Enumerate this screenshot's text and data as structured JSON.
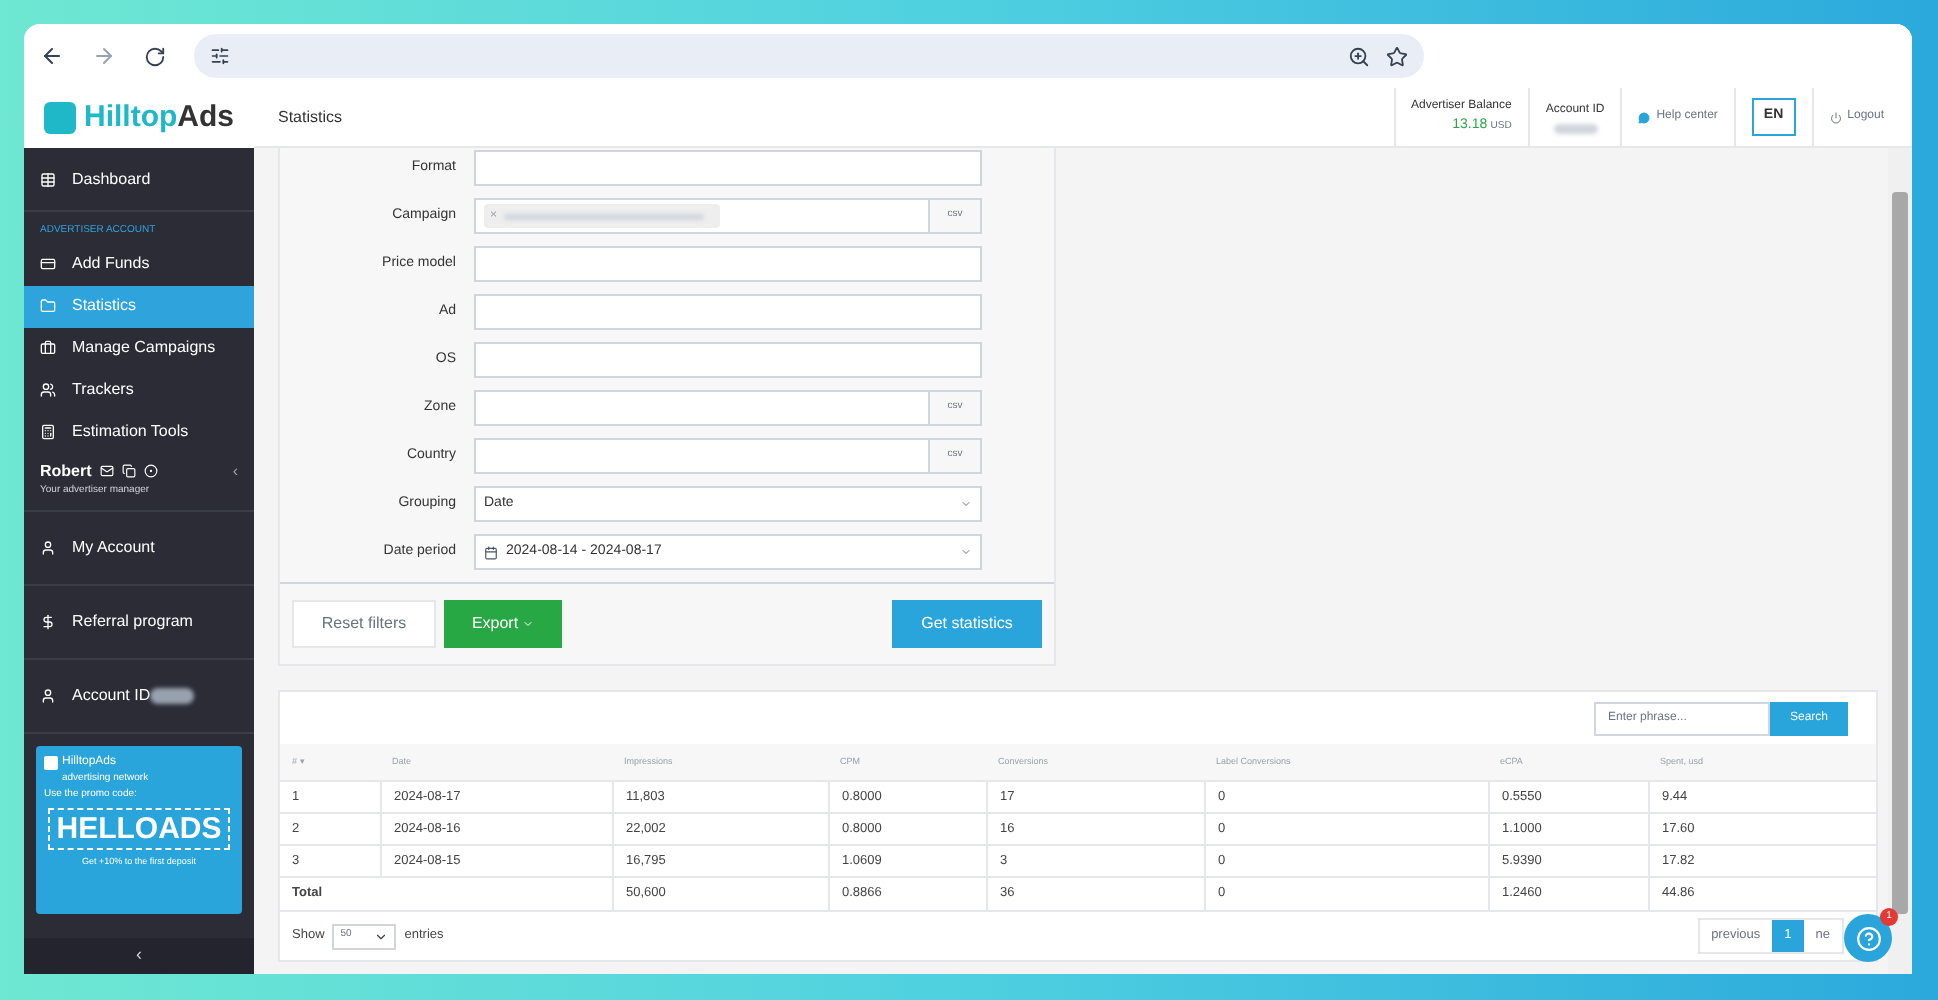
{
  "header": {
    "logo": [
      "Hilltop",
      "Ads"
    ],
    "title": "Statistics",
    "balance_label": "Advertiser Balance",
    "balance_value": "13.18",
    "balance_currency": "USD",
    "account_label": "Account ID",
    "help": "Help center",
    "language": "EN",
    "logout": "Logout"
  },
  "sidebar": {
    "top_items": [
      {
        "label": "Dashboard",
        "selected": false
      }
    ],
    "section_label": "ADVERTISER ACCOUNT",
    "account_items": [
      {
        "label": "Add Funds",
        "selected": false
      },
      {
        "label": "Statistics",
        "selected": true
      },
      {
        "label": "Manage Campaigns",
        "selected": false
      },
      {
        "label": "Trackers",
        "selected": false
      },
      {
        "label": "Estimation Tools",
        "selected": false
      }
    ],
    "manager": {
      "name": "Robert",
      "role": "Your advertiser manager",
      "collapse": "‹"
    },
    "bottom_items": [
      {
        "label": "My Account"
      },
      {
        "label": "Referral program"
      },
      {
        "label": "Account ID"
      }
    ],
    "promo": {
      "brand": "HilltopAds",
      "tagline": "advertising network",
      "intro": "Use the promo code:",
      "code": "HELLOADS",
      "offer": "Get +10% to the first deposit"
    },
    "collapse": "‹"
  },
  "filters": {
    "fields": [
      {
        "label": "Format",
        "kind": "text"
      },
      {
        "label": "Campaign",
        "kind": "tag",
        "tag_remove": "×",
        "csv": "csv"
      },
      {
        "label": "Price model",
        "kind": "text"
      },
      {
        "label": "Ad",
        "kind": "text"
      },
      {
        "label": "OS",
        "kind": "text"
      },
      {
        "label": "Zone",
        "kind": "csv",
        "csv": "csv"
      },
      {
        "label": "Country",
        "kind": "csv",
        "csv": "csv"
      },
      {
        "label": "Grouping",
        "kind": "select",
        "value": "Date"
      },
      {
        "label": "Date period",
        "kind": "date",
        "value": "2024-08-14 - 2024-08-17"
      }
    ],
    "reset": "Reset filters",
    "export": "Export",
    "submit": "Get statistics"
  },
  "table": {
    "search_placeholder": "Enter phrase...",
    "search_button": "Search",
    "columns": [
      "# ▾",
      "Date",
      "Impressions",
      "CPM",
      "Conversions",
      "Label Conversions",
      "eCPA",
      "Spent, usd"
    ],
    "rows": [
      [
        "1",
        "2024-08-17",
        "11,803",
        "0.8000",
        "17",
        "0",
        "0.5550",
        "9.44"
      ],
      [
        "2",
        "2024-08-16",
        "22,002",
        "0.8000",
        "16",
        "0",
        "1.1000",
        "17.60"
      ],
      [
        "3",
        "2024-08-15",
        "16,795",
        "1.0609",
        "3",
        "0",
        "5.9390",
        "17.82"
      ]
    ],
    "total": {
      "label": "Total",
      "values": [
        "50,600",
        "0.8866",
        "36",
        "0",
        "1.2460",
        "44.86"
      ]
    },
    "show": "Show",
    "page_size": "50",
    "entries": "entries",
    "pages": [
      {
        "label": "previous",
        "selected": false
      },
      {
        "label": "1",
        "selected": true
      },
      {
        "label": "ne",
        "selected": false
      }
    ]
  },
  "chat": {
    "badge": "1"
  }
}
